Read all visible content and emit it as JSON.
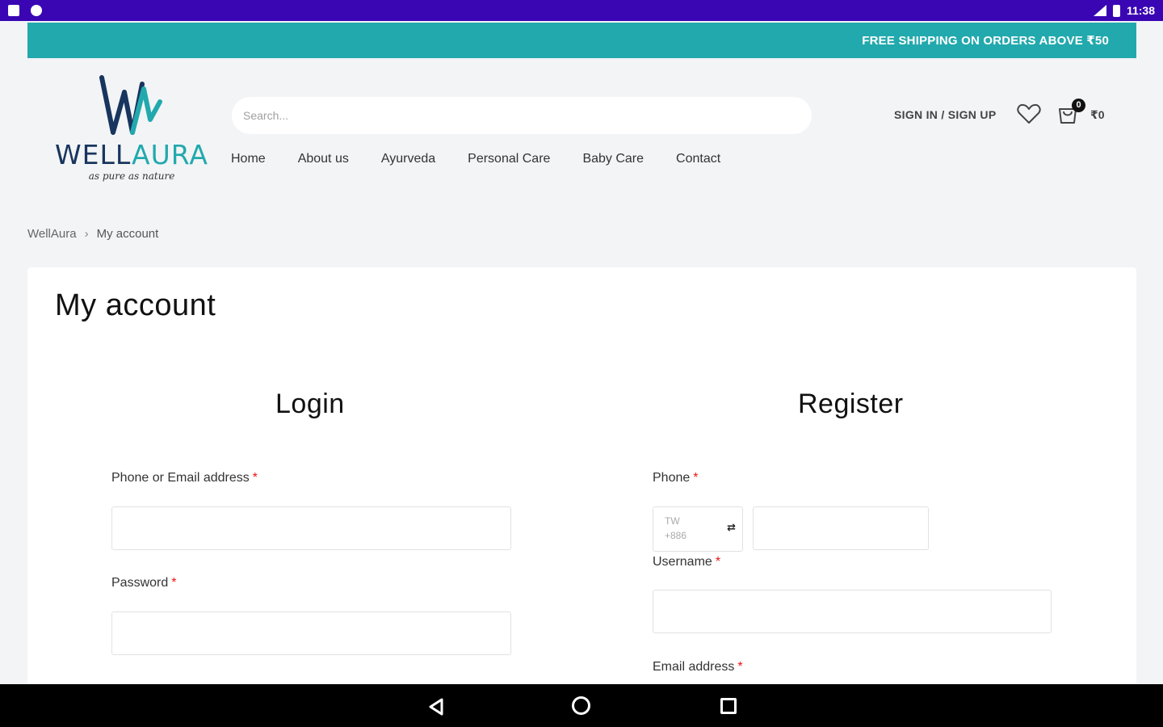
{
  "status_bar": {
    "time": "11:38"
  },
  "promo": {
    "text": "FREE SHIPPING ON ORDERS ABOVE ₹50"
  },
  "logo": {
    "brand_left": "WELL",
    "brand_right": "AURA",
    "tagline": "as pure as nature"
  },
  "header": {
    "search_placeholder": "Search...",
    "signin_label": "SIGN IN / SIGN UP",
    "cart_count": "0",
    "cart_total": "₹0"
  },
  "nav": {
    "items": [
      {
        "label": "Home"
      },
      {
        "label": "About us"
      },
      {
        "label": "Ayurveda"
      },
      {
        "label": "Personal Care"
      },
      {
        "label": "Baby Care"
      },
      {
        "label": "Contact"
      }
    ]
  },
  "breadcrumb": {
    "home": "WellAura",
    "separator": "›",
    "current": "My account"
  },
  "page": {
    "title": "My account"
  },
  "login": {
    "title": "Login",
    "identifier_label": "Phone or Email address",
    "password_label": "Password",
    "required_mark": "*"
  },
  "register": {
    "title": "Register",
    "phone_label": "Phone",
    "country_code": "TW",
    "dial_code": "+886",
    "username_label": "Username",
    "email_label": "Email address",
    "required_mark": "*"
  },
  "colors": {
    "status_bar": "#3a06b4",
    "promo": "#22a9ad",
    "brand_dark": "#18355e",
    "required": "#e11111"
  }
}
